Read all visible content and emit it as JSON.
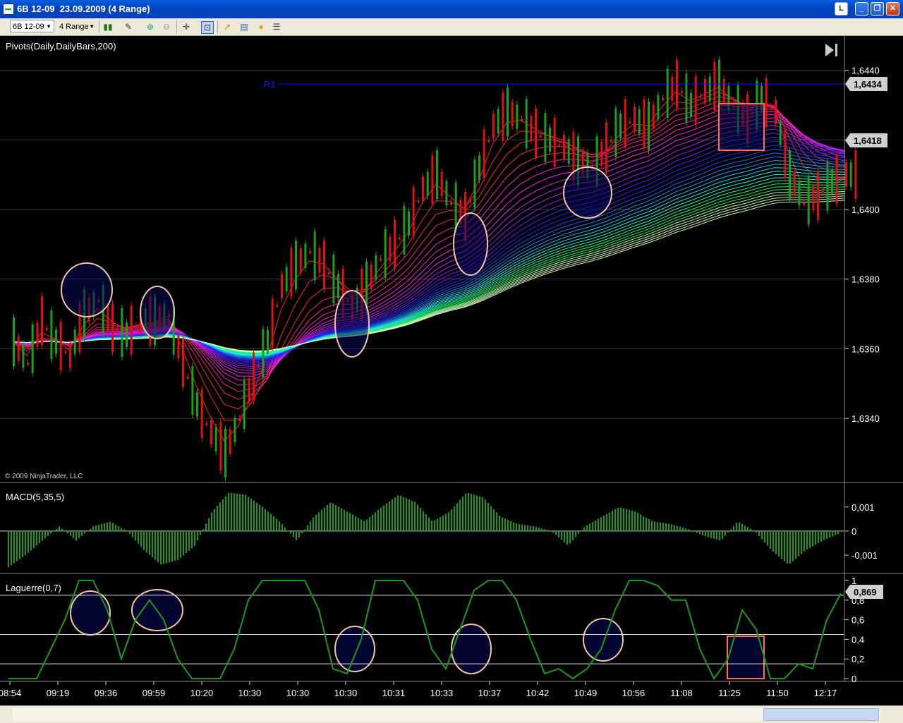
{
  "window": {
    "title": "6B 12-09  23.09.2009 (4 Range)",
    "btn_l": "L",
    "btn_min": "_",
    "btn_max": "❐",
    "btn_close": "✕"
  },
  "toolbar": {
    "instrument": "6B 12-09",
    "period": "4 Range"
  },
  "price_panel": {
    "indicator": "Pivots(Daily,DailyBars,200)",
    "r1_label": "R1",
    "r1_value": "1,6434",
    "last_price": "1,6418",
    "copyright": "© 2009 NinjaTrader, LLC",
    "y_ticks": [
      "1,6440",
      "1,6420",
      "1,6400",
      "1,6380",
      "1,6360",
      "1,6340"
    ]
  },
  "macd_panel": {
    "indicator": "MACD(5,35,5)",
    "y_ticks": [
      "0,001",
      "0",
      "-0,001"
    ]
  },
  "laguerre_panel": {
    "indicator": "Laguerre(0,7)",
    "value": "0,869",
    "y_ticks": [
      "1",
      "0,8",
      "0,6",
      "0,4",
      "0,2",
      "0"
    ]
  },
  "x_axis": [
    "08:54",
    "09:19",
    "09:36",
    "09:59",
    "10:20",
    "10:30",
    "10:30",
    "10:30",
    "10:31",
    "10:33",
    "10:37",
    "10:42",
    "10:49",
    "10:56",
    "11:08",
    "11:25",
    "11:50",
    "12:17"
  ],
  "chart_data": [
    {
      "type": "line",
      "title": "Pivots(Daily,DailyBars,200)",
      "ylim": [
        1.6322,
        1.6448
      ],
      "r1": 1.6434,
      "last": 1.6418,
      "x": [
        0,
        20,
        40,
        60,
        80,
        100,
        120,
        140,
        160,
        180,
        200,
        220,
        240,
        260,
        280,
        300,
        320,
        340,
        360,
        380,
        400,
        420,
        440,
        460,
        480,
        500,
        520,
        540,
        560,
        580,
        600,
        620,
        640,
        660,
        680,
        700,
        720,
        740,
        760,
        780,
        800,
        820,
        840,
        860,
        880,
        900,
        920,
        940,
        960,
        980,
        1000,
        1020,
        1040,
        1060,
        1080,
        1100,
        1120,
        1140,
        1160,
        1180
      ],
      "close": [
        1.6362,
        1.6356,
        1.6368,
        1.6362,
        1.6358,
        1.637,
        1.6374,
        1.6366,
        1.6364,
        1.6368,
        1.6368,
        1.637,
        1.6356,
        1.6344,
        1.6336,
        1.633,
        1.634,
        1.6352,
        1.6362,
        1.6378,
        1.6384,
        1.6388,
        1.6384,
        1.6378,
        1.6372,
        1.6378,
        1.6386,
        1.639,
        1.6396,
        1.6406,
        1.641,
        1.6402,
        1.6398,
        1.6412,
        1.6424,
        1.6428,
        1.6426,
        1.6422,
        1.642,
        1.6418,
        1.6414,
        1.6412,
        1.6418,
        1.6424,
        1.6426,
        1.6424,
        1.6432,
        1.6436,
        1.643,
        1.6434,
        1.6436,
        1.643,
        1.6426,
        1.6432,
        1.6428,
        1.641,
        1.6402,
        1.6404,
        1.6408,
        1.641
      ]
    },
    {
      "type": "bar",
      "title": "MACD(5,35,5)",
      "ylim": [
        -0.0017,
        0.0019
      ],
      "values": [
        -0.0015,
        -0.001,
        -0.0004,
        0.0002,
        -0.0004,
        0.0002,
        0.0004,
        0.0,
        -0.0008,
        -0.0014,
        -0.0012,
        -0.0006,
        0.0008,
        0.0016,
        0.0015,
        0.001,
        0.0004,
        -0.0004,
        0.0006,
        0.0012,
        0.0008,
        0.0004,
        0.001,
        0.0015,
        0.0012,
        0.0004,
        0.0008,
        0.0016,
        0.0014,
        0.0006,
        0.0003,
        0.0002,
        0.0,
        -0.0006,
        0.0002,
        0.0006,
        0.001,
        0.0008,
        0.0004,
        0.0003,
        0.0001,
        -0.0002,
        -0.0004,
        0.0004,
        0.0,
        -0.0008,
        -0.0014,
        -0.0008,
        -0.0004,
        -0.0001
      ]
    },
    {
      "type": "line",
      "title": "Laguerre(0,7)",
      "ylim": [
        0,
        1
      ],
      "values": [
        0.0,
        0.0,
        0.0,
        0.3,
        0.6,
        1.0,
        1.0,
        0.7,
        0.2,
        0.6,
        0.8,
        0.6,
        0.2,
        0.0,
        0.0,
        0.0,
        0.3,
        0.8,
        1.0,
        1.0,
        1.0,
        1.0,
        0.7,
        0.1,
        0.05,
        0.4,
        1.0,
        1.0,
        1.0,
        0.8,
        0.3,
        0.1,
        0.5,
        0.9,
        1.0,
        1.0,
        0.8,
        0.4,
        0.05,
        0.1,
        0.0,
        0.1,
        0.3,
        0.7,
        1.0,
        1.0,
        0.95,
        0.8,
        0.8,
        0.3,
        0.0,
        0.2,
        0.7,
        0.5,
        0.0,
        0.0,
        0.15,
        0.1,
        0.6,
        0.87
      ]
    }
  ],
  "colors": {
    "bull": "#1aa11a",
    "bear": "#e01010",
    "grid": "#3a3a3a",
    "macd": "#1a9a1a",
    "laguerre": "#1a9a1a",
    "r1": "#1414ff",
    "circle": "#f0c8a0",
    "box": "#ff7050"
  }
}
